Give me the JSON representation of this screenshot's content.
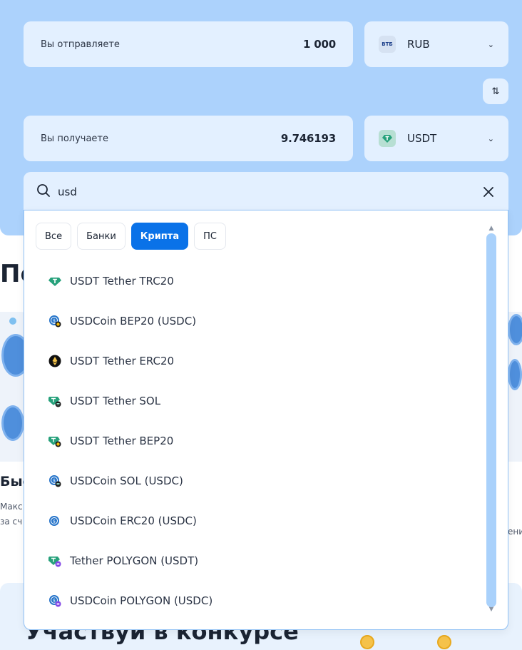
{
  "exchange": {
    "send": {
      "label": "Вы отправляете",
      "value": "1 000",
      "currency": "RUB",
      "currency_icon_text": "ВТБ"
    },
    "receive": {
      "label": "Вы получаете",
      "value": "9.746193",
      "currency": "USDT"
    },
    "swap_icon": "swap-arrows-icon"
  },
  "search": {
    "value": "usd",
    "search_icon": "search-icon",
    "clear_icon": "close-icon"
  },
  "dropdown": {
    "tabs": [
      {
        "label": "Все",
        "active": false
      },
      {
        "label": "Банки",
        "active": false
      },
      {
        "label": "Крипта",
        "active": true
      },
      {
        "label": "ПС",
        "active": false
      }
    ],
    "items": [
      {
        "label": "USDT Tether TRC20"
      },
      {
        "label": "USDCoin BEP20 (USDC)"
      },
      {
        "label": "USDT Tether ERC20"
      },
      {
        "label": "USDT Tether SOL"
      },
      {
        "label": "USDT Tether BEP20"
      },
      {
        "label": "USDCoin SOL (USDC)"
      },
      {
        "label": "USDCoin ERC20 (USDC)"
      },
      {
        "label": "Tether POLYGON (USDT)"
      },
      {
        "label": "USDCoin POLYGON (USDC)"
      }
    ]
  },
  "background": {
    "heading_partial": "По",
    "card_title_partial": "Быс",
    "card_text_partial_1": "Макс",
    "card_text_partial_2": "за сч",
    "card_text_right_partial": "ени",
    "contest_title": "Участвуй в конкурсе"
  },
  "colors": {
    "accent": "#0a72e8",
    "panel": "#acd2fc",
    "field": "#e3f0ff",
    "tether": "#26a17b",
    "usdc": "#2775ca"
  }
}
